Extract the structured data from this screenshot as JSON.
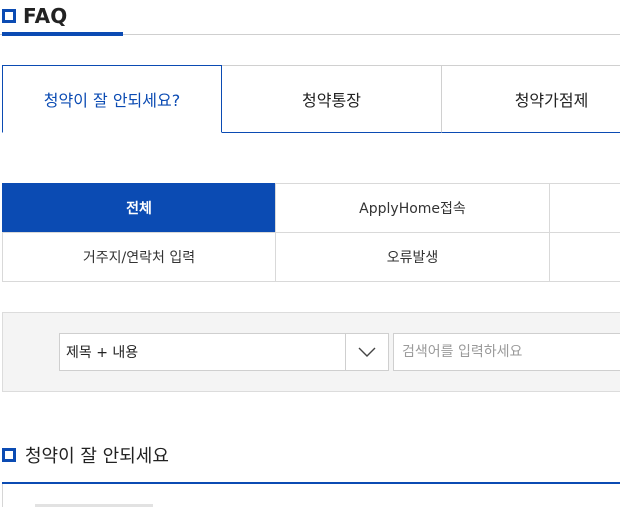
{
  "header": {
    "title": "FAQ"
  },
  "main_tabs": [
    {
      "label": "청약이 잘 안되세요?",
      "active": true
    },
    {
      "label": "청약통장",
      "active": false
    },
    {
      "label": "청약가점제",
      "active": false
    }
  ],
  "sub_categories": {
    "row1": [
      {
        "label": "전체",
        "active": true
      },
      {
        "label": "ApplyHome접속",
        "active": false
      },
      {
        "label": "",
        "active": false
      }
    ],
    "row2": [
      {
        "label": "거주지/연락처 입력",
        "active": false
      },
      {
        "label": "오류발생",
        "active": false
      },
      {
        "label": "",
        "active": false
      }
    ]
  },
  "search": {
    "select_value": "제목 + 내용",
    "placeholder": "검색어를 입력하세요"
  },
  "section": {
    "title": "청약이 잘 안되세요"
  },
  "colors": {
    "accent": "#0b4bb3",
    "border": "#d9d9d9",
    "panel_bg": "#f4f4f4"
  },
  "icons": {
    "title_marker": "square-marker-icon",
    "select_arrow": "chevron-down-icon"
  }
}
